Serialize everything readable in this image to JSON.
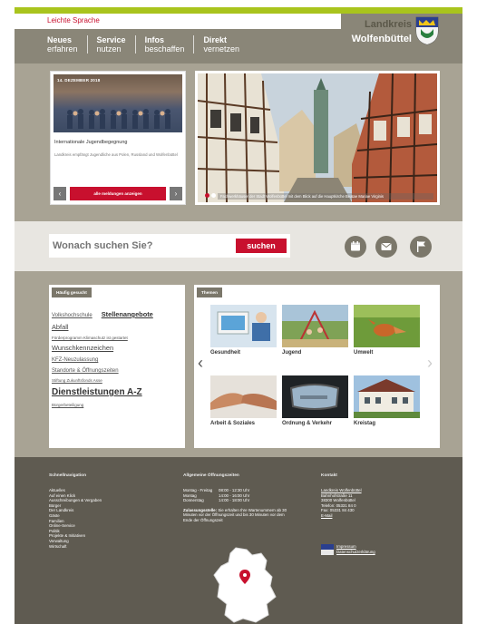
{
  "header": {
    "leichte_sprache": "Leichte Sprache",
    "nav": [
      {
        "line1": "Neues",
        "line2": "erfahren"
      },
      {
        "line1": "Service",
        "line2": "nutzen"
      },
      {
        "line1": "Infos",
        "line2": "beschaffen"
      },
      {
        "line1": "Direkt",
        "line2": "vernetzen"
      }
    ],
    "logo_line1": "Landkreis",
    "logo_line2": "Wolfenbüttel"
  },
  "news": {
    "date": "14. DEZEMBER 2018",
    "title": "Internationale Jugendbegegnung",
    "text": "Landkreis empfängt Jugendliche aus Polen, Russland und Wolfenbüttel",
    "all_button": "alle meldungen anzeigen",
    "prev": "‹",
    "next": "›"
  },
  "hero": {
    "caption": "Fachwerkhäuser der Stadt Wolfenbüttel mit dem Blick auf die Hauptkirche Beatae Mariae Virginis"
  },
  "search": {
    "placeholder": "Wonach suchen Sie?",
    "button": "suchen",
    "icons": [
      "calendar-icon",
      "mail-icon",
      "flag-icon"
    ]
  },
  "frequent": {
    "label": "Häufig gesucht",
    "items": [
      {
        "text": "Volkshochschule",
        "size": "small"
      },
      {
        "text": "Stellenangebote",
        "size": "medium"
      },
      {
        "text": "Abfall",
        "size": "medium"
      },
      {
        "text": "Förderprogramm Klimaschutz ist gestartet",
        "size": "tiny"
      },
      {
        "text": "Wunschkennzeichen",
        "size": "medium"
      },
      {
        "text": "KFZ-Neuzulassung",
        "size": "small"
      },
      {
        "text": "Standorte & Öffnungszeiten",
        "size": "small"
      },
      {
        "text": "Stiftung Zukunftsfonds Asse",
        "size": "tiny"
      },
      {
        "text": "Dienstleistungen A-Z",
        "size": "large"
      },
      {
        "text": "Bürgerbeteiligung",
        "size": "tiny"
      }
    ]
  },
  "themes": {
    "label": "Themen",
    "tiles": [
      {
        "label": "Gesundheit"
      },
      {
        "label": "Jugend"
      },
      {
        "label": "Umwelt"
      },
      {
        "label": "Arbeit & Soziales"
      },
      {
        "label": "Ordnung & Verkehr"
      },
      {
        "label": "Kreistag"
      }
    ],
    "prev": "‹",
    "next": "›"
  },
  "footer": {
    "quicknav_heading": "Schnellnavigation",
    "quicknav": [
      "Aktuelles",
      "Auf einen Klick",
      "Ausschreibungen & Vergaben",
      "Bürger",
      "Der Landkreis",
      "Gäste",
      "Familien",
      "Online-Service",
      "Politik",
      "Projekte & Initiativen",
      "Verwaltung",
      "Wirtschaft"
    ],
    "hours_heading": "Allgemeine Öffnungszeiten",
    "hours": [
      {
        "day": "Montag - Freitag",
        "time": "08:00 - 12:30 Uhr"
      },
      {
        "day": "Montag",
        "time": "14:00 - 16:00 Uhr"
      },
      {
        "day": "Donnerstag",
        "time": "14:00 - 18:00 Uhr"
      }
    ],
    "hours_note_bold": "Zulassungsstelle:",
    "hours_note": "Sie erhalten Ihre Wartenummern ab 30 Minuten vor der Öffnungszeit und bis 30 Minuten vor dem Ende der Öffnungszeit",
    "contact_heading": "Kontakt",
    "contact_link": "Landkreis Wolfenbüttel",
    "contact": [
      "Bahnhofstraße 11",
      "38300 Wolfenbüttel",
      "Telefon: 05331 84 0",
      "Fax: 05331 84 430"
    ],
    "email": "E-Mail",
    "impressum": "Impressum",
    "datenschutz": "Datenschutzerklärung"
  },
  "colors": {
    "accent_red": "#c8102e",
    "accent_green": "#a9c41d",
    "header_grey": "#8a8678",
    "footer_grey": "#5f5b51"
  }
}
